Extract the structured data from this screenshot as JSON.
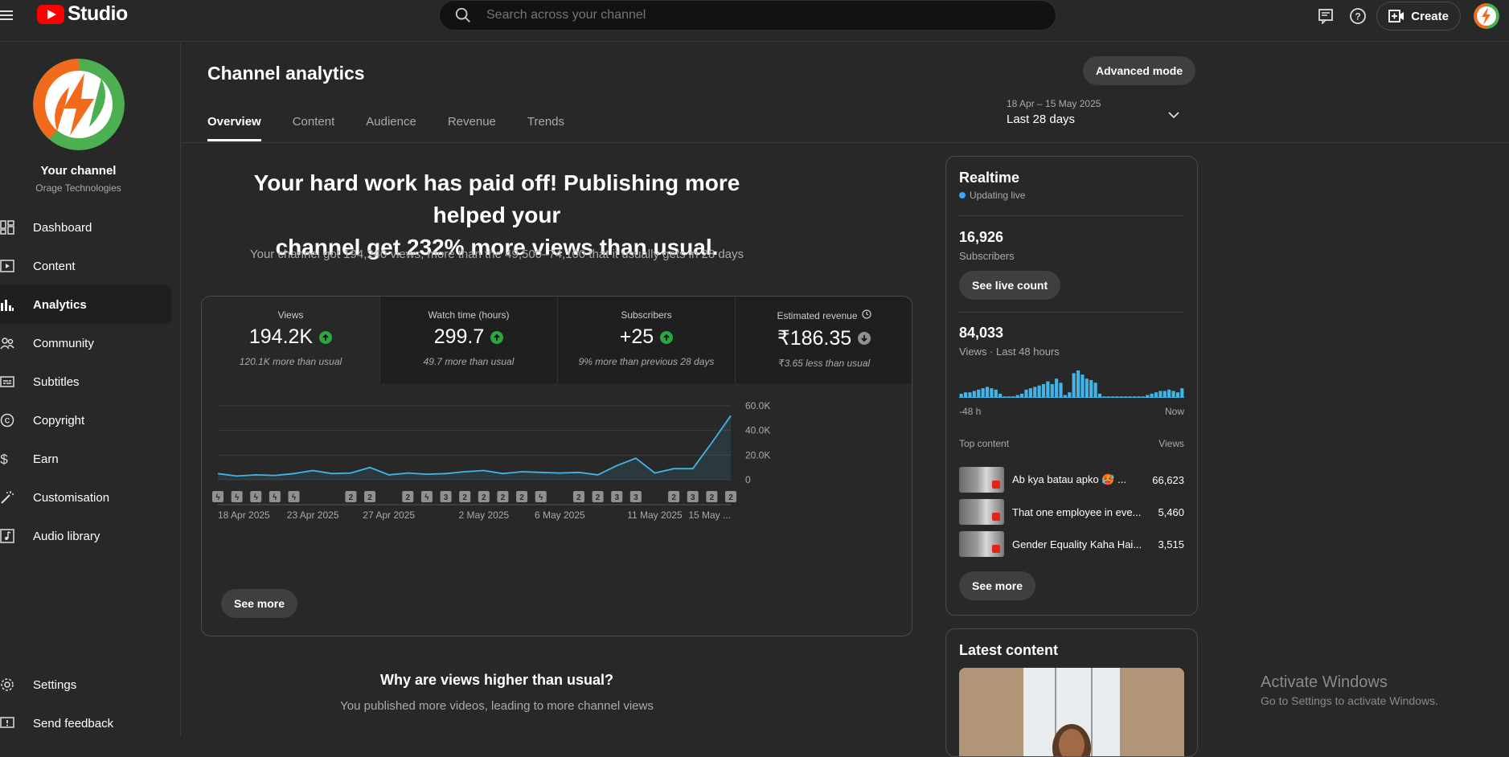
{
  "app": {
    "logo_text": "Studio"
  },
  "search": {
    "placeholder": "Search across your channel"
  },
  "topbar": {
    "create_label": "Create"
  },
  "channel": {
    "name": "Your channel",
    "handle": "Orage Technologies"
  },
  "sidebar": {
    "items": [
      {
        "label": "Dashboard",
        "icon": "dashboard-icon"
      },
      {
        "label": "Content",
        "icon": "content-icon"
      },
      {
        "label": "Analytics",
        "icon": "analytics-icon"
      },
      {
        "label": "Community",
        "icon": "community-icon"
      },
      {
        "label": "Subtitles",
        "icon": "subtitles-icon"
      },
      {
        "label": "Copyright",
        "icon": "copyright-icon"
      },
      {
        "label": "Earn",
        "icon": "earn-icon"
      },
      {
        "label": "Customisation",
        "icon": "customisation-icon"
      },
      {
        "label": "Audio library",
        "icon": "audio-library-icon"
      }
    ],
    "settings_label": "Settings",
    "feedback_label": "Send feedback"
  },
  "page": {
    "title": "Channel analytics",
    "advanced_mode": "Advanced mode",
    "tabs": [
      "Overview",
      "Content",
      "Audience",
      "Revenue",
      "Trends"
    ],
    "date_range_dates": "18 Apr – 15 May 2025",
    "date_range_label": "Last 28 days"
  },
  "headline": {
    "line1": "Your hard work has paid off! Publishing more helped your",
    "line2": "channel get 232% more views than usual.",
    "sub": "Your channel got 194,240 views, more than the 49,500–74,100 that it usually gets in 28 days"
  },
  "metrics": [
    {
      "label": "Views",
      "value": "194.2K",
      "trend": "up",
      "note": "120.1K more than usual"
    },
    {
      "label": "Watch time (hours)",
      "value": "299.7",
      "trend": "up",
      "note": "49.7 more than usual"
    },
    {
      "label": "Subscribers",
      "value": "+25",
      "trend": "up",
      "note": "9% more than previous 28 days"
    },
    {
      "label": "Estimated revenue",
      "value": "₹186.35",
      "trend": "down",
      "note": "₹3.65 less than usual"
    }
  ],
  "chart_data": {
    "type": "area",
    "x_tick_labels": [
      "18 Apr 2025",
      "23 Apr 2025",
      "27 Apr 2025",
      "2 May 2025",
      "6 May 2025",
      "11 May 2025",
      "15 May ..."
    ],
    "y_tick_labels": [
      "0",
      "20.0K",
      "40.0K",
      "60.0K"
    ],
    "ylim": [
      0,
      60000
    ],
    "grid": true,
    "series": [
      {
        "color": "#41b4e8",
        "values": [
          5000,
          3000,
          4000,
          3500,
          5000,
          7500,
          5000,
          5500,
          10000,
          4000,
          5500,
          4500,
          5000,
          6500,
          7500,
          5000,
          6500,
          6000,
          5500,
          6000,
          4000,
          11500,
          17500,
          5500,
          9000,
          9000,
          30000,
          52000
        ]
      }
    ],
    "upload_markers": [
      "short",
      "short",
      "short",
      "short",
      "short",
      "",
      "",
      "2",
      "2",
      "",
      "2",
      "short",
      "3",
      "2",
      "2",
      "2",
      "2",
      "short",
      "",
      "2",
      "2",
      "3",
      "3",
      "",
      "2",
      "3",
      "2",
      "2"
    ]
  },
  "chart_see_more": "See more",
  "why": {
    "title": "Why are views higher than usual?",
    "sub": "You published more videos, leading to more channel views"
  },
  "realtime": {
    "title": "Realtime",
    "status": "Updating live",
    "subscribers_value": "16,926",
    "subscribers_label": "Subscribers",
    "live_count_button": "See live count",
    "views_value": "84,033",
    "views_label": "Views · Last 48 hours",
    "bars": [
      3,
      4,
      4,
      5,
      6,
      7,
      8,
      7,
      6,
      3,
      1,
      1,
      1,
      2,
      3,
      6,
      7,
      8,
      9,
      10,
      12,
      10,
      14,
      11,
      2,
      4,
      18,
      20,
      17,
      14,
      13,
      11,
      3,
      1,
      1,
      1,
      1,
      1,
      1,
      1,
      1,
      1,
      1,
      2,
      3,
      4,
      5,
      5,
      6,
      5,
      4,
      7
    ],
    "axis_left": "-48 h",
    "axis_right": "Now",
    "top_content_label": "Top content",
    "top_content_views_label": "Views",
    "top_content": [
      {
        "title": "Ab kya batau apko 🥵 ...",
        "views": "66,623"
      },
      {
        "title": "That one employee in eve...",
        "views": "5,460"
      },
      {
        "title": "Gender Equality Kaha Hai...",
        "views": "3,515"
      }
    ],
    "see_more": "See more"
  },
  "latest": {
    "title": "Latest content"
  },
  "watermark": {
    "line1": "Activate Windows",
    "line2": "Go to Settings to activate Windows."
  },
  "colors": {
    "accent": "#3ea6ff",
    "chart_line": "#41b4e8",
    "up": "#2ba640",
    "brand_red": "#ff0000"
  }
}
